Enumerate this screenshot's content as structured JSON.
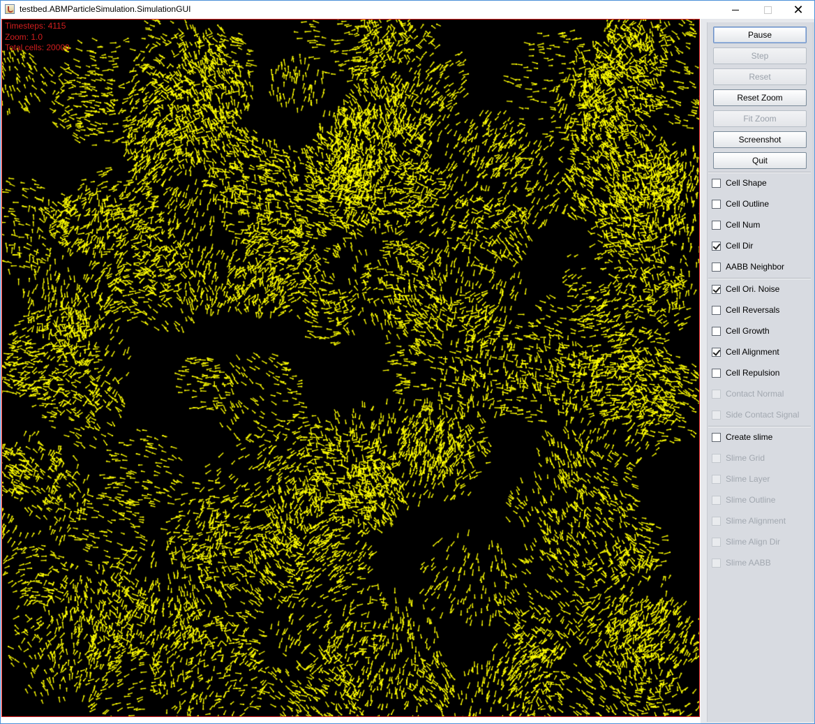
{
  "window": {
    "title": "testbed.ABMParticleSimulation.SimulationGUI",
    "minimize_icon": "minimize-icon",
    "maximize_icon": "maximize-icon",
    "close_glyph": "✕"
  },
  "overlay": {
    "line1": "Timesteps: 4115",
    "line2": "Zoom: 1.0",
    "line3": "Total cells: 20000"
  },
  "simulation": {
    "background": "#000000",
    "cell_color": "#ffff00",
    "border_color": "#e02020"
  },
  "buttons": {
    "pause": "Pause",
    "step": "Step",
    "reset": "Reset",
    "reset_zoom": "Reset Zoom",
    "fit_zoom": "Fit Zoom",
    "screenshot": "Screenshot",
    "quit": "Quit"
  },
  "checkboxes": {
    "cell_shape": {
      "label": "Cell Shape",
      "checked": false,
      "enabled": true
    },
    "cell_outline": {
      "label": "Cell Outline",
      "checked": false,
      "enabled": true
    },
    "cell_num": {
      "label": "Cell Num",
      "checked": false,
      "enabled": true
    },
    "cell_dir": {
      "label": "Cell Dir",
      "checked": true,
      "enabled": true
    },
    "aabb_neighbor": {
      "label": "AABB Neighbor",
      "checked": false,
      "enabled": true
    },
    "cell_ori_noise": {
      "label": "Cell Ori. Noise",
      "checked": true,
      "enabled": true
    },
    "cell_reversals": {
      "label": "Cell Reversals",
      "checked": false,
      "enabled": true
    },
    "cell_growth": {
      "label": "Cell Growth",
      "checked": false,
      "enabled": true
    },
    "cell_alignment": {
      "label": "Cell Alignment",
      "checked": true,
      "enabled": true
    },
    "cell_repulsion": {
      "label": "Cell Repulsion",
      "checked": false,
      "enabled": true
    },
    "contact_normal": {
      "label": "Contact Normal",
      "checked": false,
      "enabled": false
    },
    "side_contact_signal": {
      "label": "Side Contact Signal",
      "checked": false,
      "enabled": false
    },
    "create_slime": {
      "label": "Create slime",
      "checked": false,
      "enabled": true
    },
    "slime_grid": {
      "label": "Slime Grid",
      "checked": false,
      "enabled": false
    },
    "slime_layer": {
      "label": "Slime Layer",
      "checked": false,
      "enabled": false
    },
    "slime_outline": {
      "label": "Slime Outline",
      "checked": false,
      "enabled": false
    },
    "slime_alignment": {
      "label": "Slime Alignment",
      "checked": false,
      "enabled": false
    },
    "slime_align_dir": {
      "label": "Slime Align Dir",
      "checked": false,
      "enabled": false
    },
    "slime_aabb": {
      "label": "Slime AABB",
      "checked": false,
      "enabled": false
    }
  }
}
